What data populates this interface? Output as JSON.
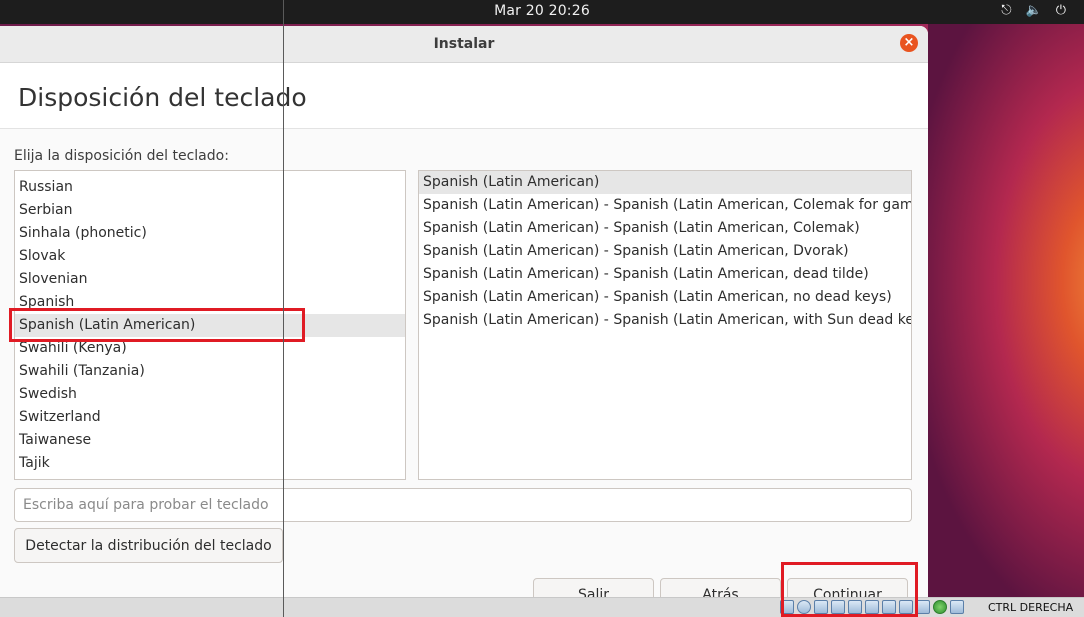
{
  "topbar": {
    "clock": "Mar 20  20:26",
    "icons": [
      "network-icon",
      "volume-icon",
      "power-icon"
    ]
  },
  "window": {
    "title": "Instalar",
    "page_title": "Disposición del teclado",
    "prompt": "Elija la disposición del teclado:",
    "layouts": [
      "Russian",
      "Serbian",
      "Sinhala (phonetic)",
      "Slovak",
      "Slovenian",
      "Spanish",
      "Spanish (Latin American)",
      "Swahili (Kenya)",
      "Swahili (Tanzania)",
      "Swedish",
      "Switzerland",
      "Taiwanese",
      "Tajik"
    ],
    "selected_layout": "Spanish (Latin American)",
    "variants": [
      "Spanish (Latin American)",
      "Spanish (Latin American) - Spanish (Latin American, Colemak for gaming)",
      "Spanish (Latin American) - Spanish (Latin American, Colemak)",
      "Spanish (Latin American) - Spanish (Latin American, Dvorak)",
      "Spanish (Latin American) - Spanish (Latin American, dead tilde)",
      "Spanish (Latin American) - Spanish (Latin American, no dead keys)",
      "Spanish (Latin American) - Spanish (Latin American, with Sun dead keys)"
    ],
    "selected_variant": "Spanish (Latin American)",
    "test_placeholder": "Escriba aquí para probar el teclado",
    "detect_label": "Detectar la distribución del teclado",
    "quit_label": "Salir",
    "back_label": "Atrás",
    "continue_label": "Continuar"
  },
  "vbox": {
    "host_key": "CTRL DERECHA"
  },
  "colors": {
    "accent": "#e95420",
    "highlight": "#e01b24"
  }
}
